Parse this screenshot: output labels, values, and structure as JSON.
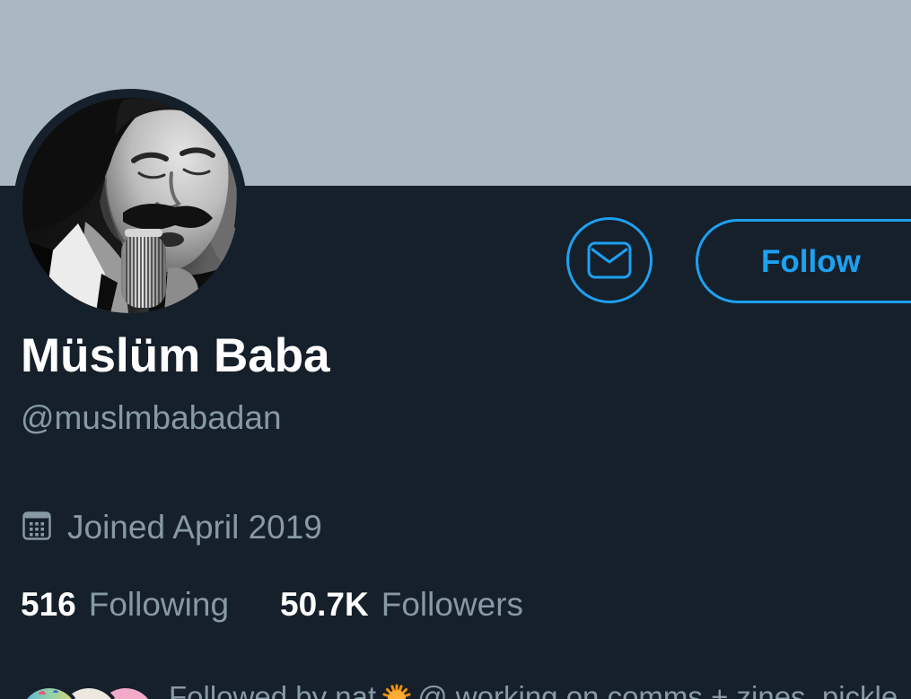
{
  "profile": {
    "display_name": "Müslüm Baba",
    "handle": "@muslmbabadan",
    "joined": "Joined April 2019",
    "joined_icon": "calendar-icon",
    "stats": {
      "following": {
        "count": "516",
        "label": "Following"
      },
      "followers": {
        "count": "50.7K",
        "label": "Followers"
      }
    }
  },
  "actions": {
    "message_icon": "envelope-icon",
    "follow_label": "Follow"
  },
  "followed_by": {
    "lead": "Followed by nat",
    "emoji": "sun-emoji-icon",
    "trail": "@ working on comms + zines, pickle"
  },
  "colors": {
    "bg": "#15202b",
    "banner": "#aab8c2",
    "accent": "#1da1f2",
    "text_primary": "#ffffff",
    "text_secondary": "#8899a6"
  }
}
